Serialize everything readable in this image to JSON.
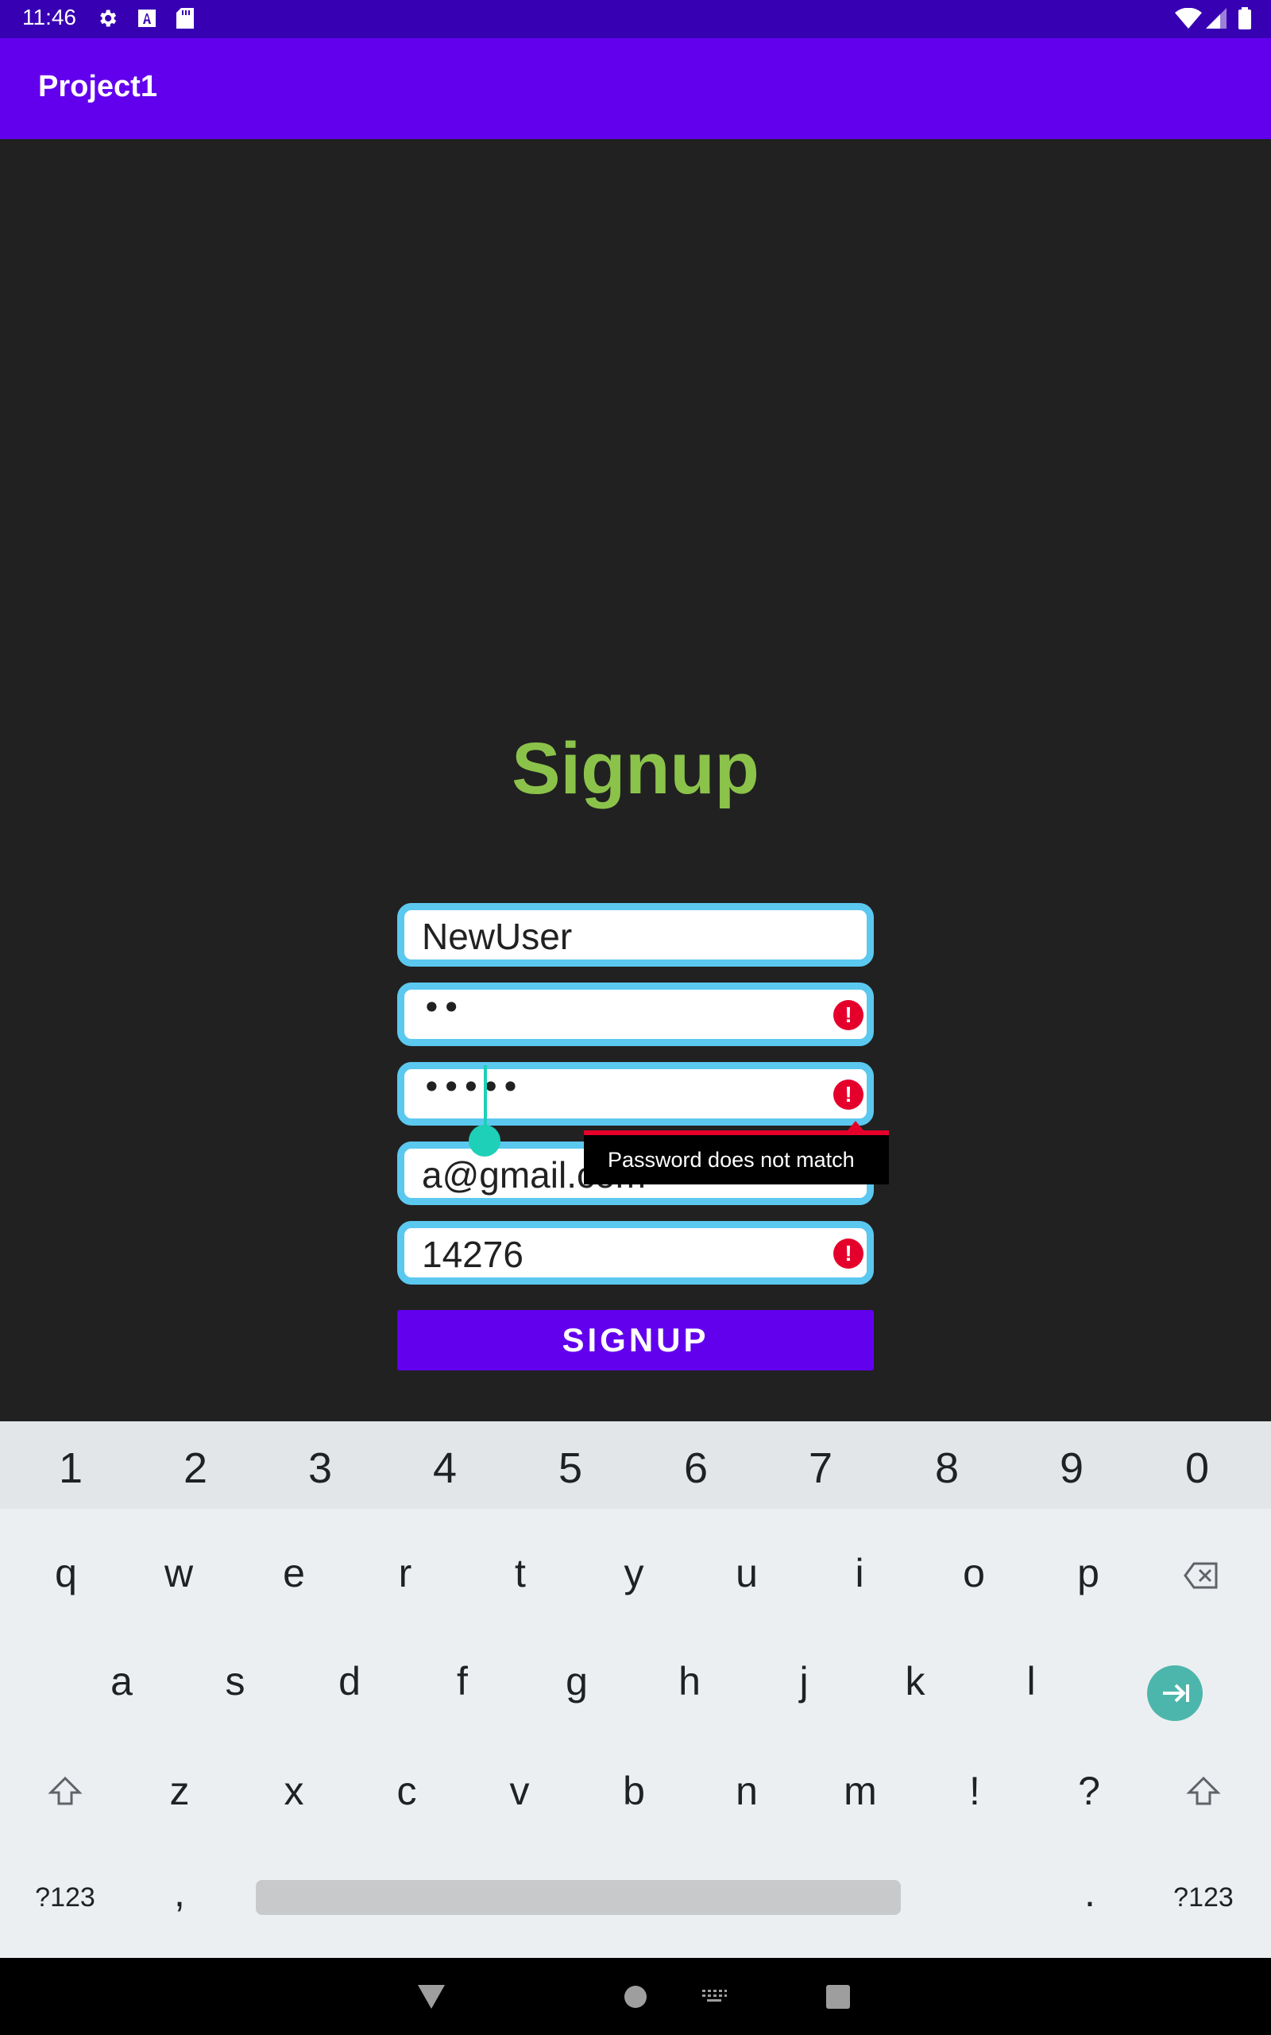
{
  "status_bar": {
    "time": "11:46",
    "icons": [
      "settings-icon",
      "font-icon",
      "sd-card-icon",
      "wifi-icon",
      "signal-icon",
      "battery-icon"
    ]
  },
  "app_bar": {
    "title": "Project1"
  },
  "form": {
    "heading": "Signup",
    "fields": {
      "username": {
        "value": "NewUser"
      },
      "password": {
        "value": "••"
      },
      "confirm_password": {
        "value": "•••••"
      },
      "email": {
        "value": "a@gmail.com"
      },
      "code": {
        "value": "14276"
      }
    },
    "error_message": "Password does not match",
    "submit_label": "SIGNUP"
  },
  "keyboard": {
    "number_row": [
      "1",
      "2",
      "3",
      "4",
      "5",
      "6",
      "7",
      "8",
      "9",
      "0"
    ],
    "row1": [
      "q",
      "w",
      "e",
      "r",
      "t",
      "y",
      "u",
      "i",
      "o",
      "p"
    ],
    "row2": [
      "a",
      "s",
      "d",
      "f",
      "g",
      "h",
      "j",
      "k",
      "l"
    ],
    "row3": [
      "z",
      "x",
      "c",
      "v",
      "b",
      "n",
      "m",
      "!",
      "?"
    ],
    "symbols_label": "?123",
    "comma": ",",
    "period": "."
  },
  "colors": {
    "status_bar": "#3700b3",
    "app_bar": "#6200ee",
    "heading": "#8bc34a",
    "field_border": "#5bc8ef",
    "error": "#e5002b",
    "cursor": "#1ed0b8"
  }
}
